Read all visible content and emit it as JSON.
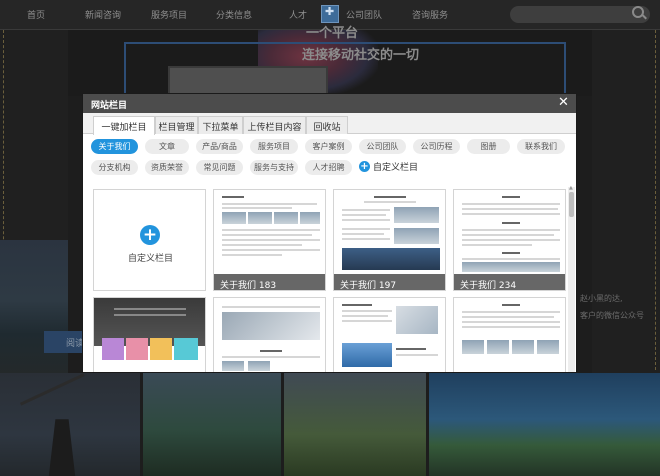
{
  "site": {
    "nav": [
      "首页",
      "新闻咨询",
      "服务项目",
      "分类信息",
      "人才",
      "公司团队",
      "咨询服务"
    ],
    "banner_line1": "一个平台",
    "banner_line2": "连接移动社交的一切",
    "side_text1": "赵小黑的达,",
    "side_text2": "客户的微信公众号",
    "left_button": "阅读"
  },
  "modal": {
    "title": "网站栏目",
    "close_glyph": "✕",
    "tabs": [
      {
        "label": "一键加栏目",
        "active": true
      },
      {
        "label": "栏目管理",
        "active": false
      },
      {
        "label": "下拉菜单",
        "active": false
      },
      {
        "label": "上传栏目内容",
        "active": false
      },
      {
        "label": "回收站",
        "active": false
      }
    ],
    "chips_row1": [
      "关于我们",
      "文章",
      "产品/商品",
      "服务项目",
      "客户案例",
      "公司团队",
      "公司历程",
      "图册",
      "联系我们"
    ],
    "chips_row2": [
      "分支机构",
      "资质荣誉",
      "常见问题",
      "服务与支持",
      "人才招聘"
    ],
    "active_chip": "关于我们",
    "add_column_label": "自定义栏目",
    "custom_card_label": "自定义栏目",
    "templates": [
      "关于我们 183",
      "关于我们 197",
      "关于我们 234"
    ]
  },
  "colors": {
    "accent": "#2294dd",
    "modal_header": "#4c4c4c",
    "overlay_bg": "#1d1d1d"
  },
  "icons": {
    "close": "close-icon",
    "add": "plus-icon",
    "search": "search-icon"
  }
}
